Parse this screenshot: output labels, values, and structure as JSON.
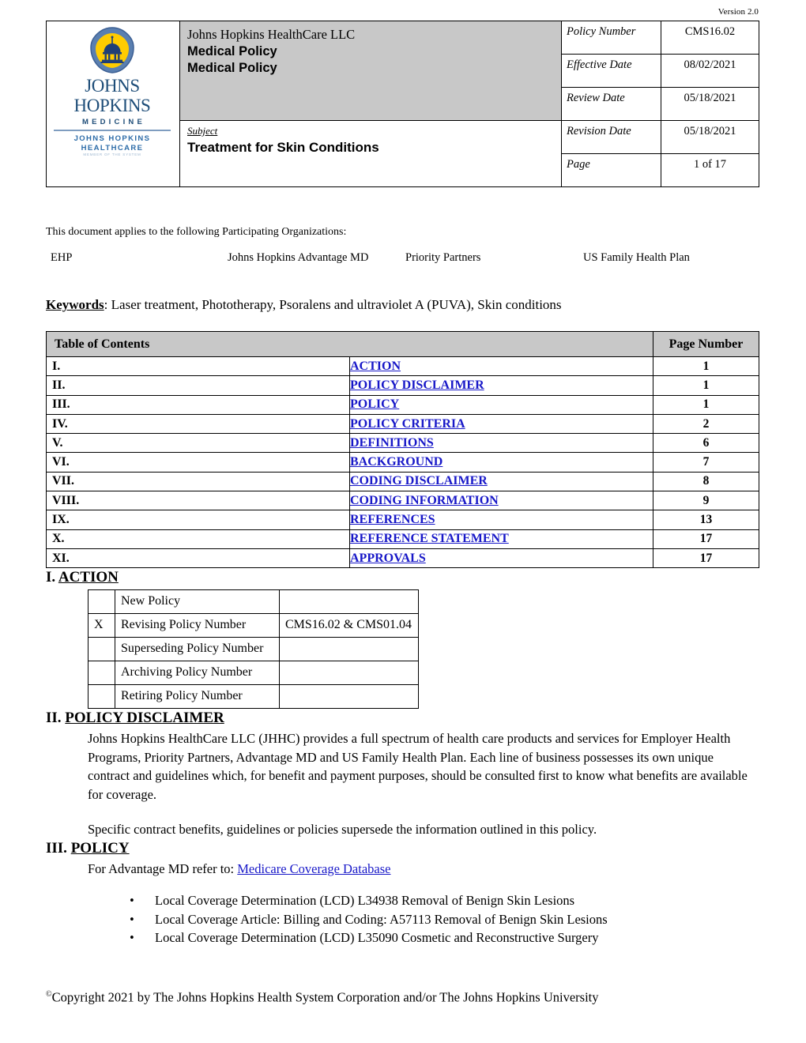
{
  "document": {
    "version_label": "Version 2.0",
    "copyright": "Copyright 2021 by The Johns Hopkins Health System Corporation and/or The Johns Hopkins University",
    "copyright_symbol": "©"
  },
  "logo": {
    "name_line": "JOHNS HOPKINS",
    "medicine_line": "MEDICINE",
    "healthcare_line1": "JOHNS HOPKINS",
    "healthcare_line2": "HEALTHCARE",
    "healthcare_sub": "MEMBER OF THE SYSTEM",
    "shield_border_color": "#4a6fa5",
    "shield_fill_color": "#ffcc00",
    "dome_color": "#1f3f77",
    "name_color": "#1f4e79"
  },
  "header": {
    "organization": "Johns Hopkins HealthCare LLC",
    "doc_type_line1": "Medical Policy",
    "doc_type_line2": "Medical Policy",
    "subject_label": "Subject",
    "subject_value": "Treatment for Skin Conditions",
    "title_cell_bg": "#c8c8c8",
    "meta": [
      {
        "label": "Policy Number",
        "value": "CMS16.02"
      },
      {
        "label": "Effective Date",
        "value": "08/02/2021"
      },
      {
        "label": "Review Date",
        "value": "05/18/2021"
      },
      {
        "label": "Revision Date",
        "value": "05/18/2021"
      },
      {
        "label": "Page",
        "value": "1 of 17"
      }
    ]
  },
  "participating": {
    "intro": "This document applies to the following Participating Organizations:",
    "organizations": [
      "EHP",
      "Johns Hopkins Advantage MD",
      "Priority Partners",
      "US Family Health Plan"
    ]
  },
  "keywords": {
    "label": "Keywords",
    "separator": ": ",
    "value": "Laser treatment, Phototherapy, Psoralens and ultraviolet A (PUVA), Skin conditions"
  },
  "toc": {
    "header_left": "Table of Contents",
    "header_right": "Page Number",
    "link_color": "#1818c8",
    "rows": [
      {
        "numeral": "I.",
        "title": "ACTION",
        "page": "1"
      },
      {
        "numeral": "II.",
        "title": "POLICY DISCLAIMER",
        "page": "1"
      },
      {
        "numeral": "III.",
        "title": "POLICY",
        "page": "1"
      },
      {
        "numeral": "IV.",
        "title": "POLICY CRITERIA",
        "page": "2"
      },
      {
        "numeral": "V.",
        "title": "DEFINITIONS",
        "page": "6"
      },
      {
        "numeral": "VI.",
        "title": "BACKGROUND",
        "page": "7"
      },
      {
        "numeral": "VII.",
        "title": "CODING DISCLAIMER",
        "page": "8"
      },
      {
        "numeral": "VIII.",
        "title": "CODING INFORMATION",
        "page": "9"
      },
      {
        "numeral": "IX.",
        "title": "REFERENCES",
        "page": "13"
      },
      {
        "numeral": "X.",
        "title": "REFERENCE STATEMENT",
        "page": "17"
      },
      {
        "numeral": "XI.",
        "title": "APPROVALS",
        "page": "17"
      }
    ]
  },
  "section_action": {
    "numeral": "I.",
    "title": "ACTION",
    "rows": [
      {
        "mark": "",
        "label": "New Policy",
        "value": ""
      },
      {
        "mark": "X",
        "label": "Revising Policy Number",
        "value": "CMS16.02 & CMS01.04"
      },
      {
        "mark": "",
        "label": "Superseding Policy Number",
        "value": ""
      },
      {
        "mark": "",
        "label": "Archiving Policy Number",
        "value": ""
      },
      {
        "mark": "",
        "label": "Retiring Policy Number",
        "value": ""
      }
    ]
  },
  "section_disclaimer": {
    "numeral": "II.",
    "title": "POLICY DISCLAIMER",
    "paragraph1": "Johns Hopkins HealthCare LLC (JHHC) provides a full spectrum of health care products and services for Employer Health Programs, Priority Partners, Advantage MD and US Family Health Plan. Each line of business possesses its own unique contract and guidelines which, for benefit and payment purposes, should be consulted first to know what benefits are available for coverage.",
    "paragraph2": "Specific contract benefits, guidelines or policies supersede the information outlined in this policy."
  },
  "section_policy": {
    "numeral": "III.",
    "title": "POLICY",
    "intro_prefix": "For Advantage MD refer to: ",
    "intro_link": "Medicare Coverage Database",
    "bullets": [
      "Local Coverage Determination (LCD) L34938 Removal of Benign Skin Lesions",
      "Local Coverage Article: Billing and Coding: A57113 Removal of Benign Skin Lesions",
      "Local Coverage Determination (LCD) L35090 Cosmetic and Reconstructive Surgery"
    ]
  }
}
